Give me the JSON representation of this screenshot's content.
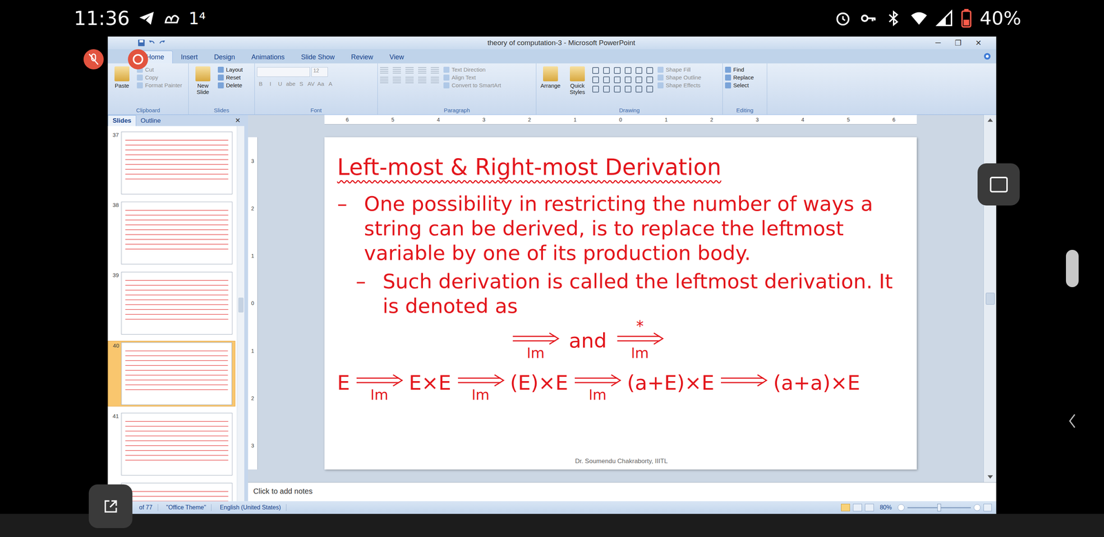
{
  "phone_status": {
    "time": "11:36",
    "badge": "1⁴",
    "battery": "40%"
  },
  "window": {
    "title": "theory of computation-3 - Microsoft PowerPoint",
    "controls": [
      "─",
      "❐",
      "✕"
    ]
  },
  "ribbon_tabs": [
    {
      "label": "Home",
      "selected": true
    },
    {
      "label": "Insert",
      "selected": false
    },
    {
      "label": "Design",
      "selected": false
    },
    {
      "label": "Animations",
      "selected": false
    },
    {
      "label": "Slide Show",
      "selected": false
    },
    {
      "label": "Review",
      "selected": false
    },
    {
      "label": "View",
      "selected": false
    }
  ],
  "ribbon_groups": [
    {
      "label": "Clipboard",
      "kind": "standard",
      "large": [
        {
          "label": "Paste",
          "disabled": false
        }
      ],
      "small": [
        {
          "label": "Cut",
          "disabled": true
        },
        {
          "label": "Copy",
          "disabled": true
        },
        {
          "label": "Format Painter",
          "disabled": true
        }
      ]
    },
    {
      "label": "Slides",
      "kind": "standard",
      "large": [
        {
          "label": "New Slide",
          "disabled": false
        }
      ],
      "small": [
        {
          "label": "Layout",
          "disabled": false
        },
        {
          "label": "Reset",
          "disabled": false
        },
        {
          "label": "Delete",
          "disabled": false
        }
      ]
    },
    {
      "label": "Font",
      "kind": "font",
      "font_size": "12",
      "format_buttons": [
        "B",
        "I",
        "U",
        "abe",
        "S",
        "AV",
        "Aa",
        "A"
      ],
      "large": [],
      "small": []
    },
    {
      "label": "Paragraph",
      "kind": "paragraph",
      "large": [],
      "small": [
        {
          "label": "Text Direction",
          "disabled": true
        },
        {
          "label": "Align Text",
          "disabled": true
        },
        {
          "label": "Convert to SmartArt",
          "disabled": true
        }
      ]
    },
    {
      "label": "Drawing",
      "kind": "drawing",
      "large": [
        {
          "label": "Arrange",
          "disabled": false
        },
        {
          "label": "Quick Styles",
          "disabled": false
        }
      ],
      "small": [
        {
          "label": "Shape Fill",
          "disabled": true
        },
        {
          "label": "Shape Outline",
          "disabled": true
        },
        {
          "label": "Shape Effects",
          "disabled": true
        }
      ]
    },
    {
      "label": "Editing",
      "kind": "standard",
      "large": [],
      "small": [
        {
          "label": "Find",
          "disabled": false
        },
        {
          "label": "Replace",
          "disabled": false
        },
        {
          "label": "Select",
          "disabled": false
        }
      ]
    }
  ],
  "slides_panel": {
    "tabs": [
      {
        "label": "Slides",
        "selected": true
      },
      {
        "label": "Outline",
        "selected": false
      }
    ],
    "close": "✕",
    "thumbnails": [
      {
        "number": "37",
        "selected": false
      },
      {
        "number": "38",
        "selected": false
      },
      {
        "number": "39",
        "selected": false
      },
      {
        "number": "40",
        "selected": true
      },
      {
        "number": "41",
        "selected": false
      },
      {
        "number": "",
        "selected": false
      }
    ]
  },
  "rulers": {
    "horizontal": [
      "6",
      "5",
      "4",
      "3",
      "2",
      "1",
      "0",
      "1",
      "2",
      "3",
      "4",
      "5",
      "6"
    ],
    "vertical": [
      "3",
      "2",
      "1",
      "0",
      "1",
      "2",
      "3"
    ]
  },
  "slide": {
    "title": "Left-most & Right-most Derivation",
    "bullets": [
      "One possibility in restricting the number of ways a string can be derived, is to replace the leftmost variable by one of its production body.",
      "Such derivation is called the leftmost derivation. It is denoted as"
    ],
    "bullet_mark": "–",
    "notation": {
      "arrows": [
        {
          "star": "",
          "label": "lm"
        },
        {
          "star": "*",
          "label": "lm"
        }
      ],
      "joiner": "and"
    },
    "derivation": {
      "start": "E",
      "steps": [
        {
          "label": "lm",
          "term": "E×E"
        },
        {
          "label": "lm",
          "term": "(E)×E"
        },
        {
          "label": "lm",
          "term": "(a+E)×E"
        },
        {
          "label": "",
          "term": "(a+a)×E"
        }
      ]
    },
    "footer": "Dr. Soumendu Chakraborty, IIITL"
  },
  "notes": {
    "placeholder": "Click to add notes"
  },
  "status_bar": {
    "slide": "of 77",
    "theme": "\"Office Theme\"",
    "language": "English (United States)",
    "zoom": "80%"
  }
}
